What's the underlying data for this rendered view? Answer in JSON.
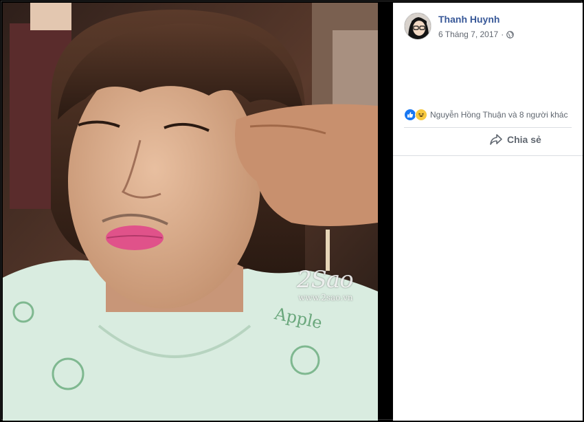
{
  "post": {
    "author": "Thanh Huynh",
    "date": "6 Tháng 7, 2017",
    "date_separator": "·",
    "privacy_icon": "globe-icon",
    "reactions_text": "Nguyễn Hồng Thuận và 8 người khác",
    "reaction_icons": [
      "like-icon",
      "haha-icon"
    ],
    "share_label": "Chia sẻ",
    "share_icon": "share-arrow-icon"
  },
  "photo": {
    "watermark_logo": "2Sao",
    "watermark_url": "www.2sao.vn",
    "shirt_print": "Apple"
  },
  "colors": {
    "author_link": "#385898",
    "meta_text": "#616770",
    "like_blue": "#1877f2",
    "divider": "#dadde1"
  }
}
